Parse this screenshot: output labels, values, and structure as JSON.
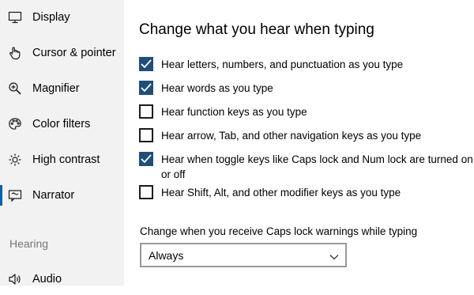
{
  "sidebar": {
    "items": [
      {
        "label": "Display",
        "icon": "display-icon",
        "selected": false
      },
      {
        "label": "Cursor & pointer",
        "icon": "cursor-pointer-icon",
        "selected": false
      },
      {
        "label": "Magnifier",
        "icon": "magnifier-icon",
        "selected": false
      },
      {
        "label": "Color filters",
        "icon": "color-filters-icon",
        "selected": false
      },
      {
        "label": "High contrast",
        "icon": "high-contrast-icon",
        "selected": false
      },
      {
        "label": "Narrator",
        "icon": "narrator-icon",
        "selected": true
      }
    ],
    "section_header": "Hearing",
    "hearing_items": [
      {
        "label": "Audio",
        "icon": "audio-icon"
      }
    ]
  },
  "main": {
    "heading": "Change what you hear when typing",
    "checkboxes": [
      {
        "label": "Hear letters, numbers, and punctuation as you type",
        "checked": true
      },
      {
        "label": "Hear words as you type",
        "checked": true
      },
      {
        "label": "Hear function keys as you type",
        "checked": false
      },
      {
        "label": "Hear arrow, Tab, and other navigation keys as you type",
        "checked": false
      },
      {
        "label": "Hear when toggle keys like Caps lock and Num lock are turned on or off",
        "checked": true
      },
      {
        "label": "Hear Shift, Alt, and other modifier keys as you type",
        "checked": false
      }
    ],
    "dropdown": {
      "label": "Change when you receive Caps lock warnings while typing",
      "value": "Always"
    }
  },
  "colors": {
    "accent": "#1f4e79",
    "selection_bar": "#0063b1",
    "sidebar_bg": "#f2f2f2"
  }
}
